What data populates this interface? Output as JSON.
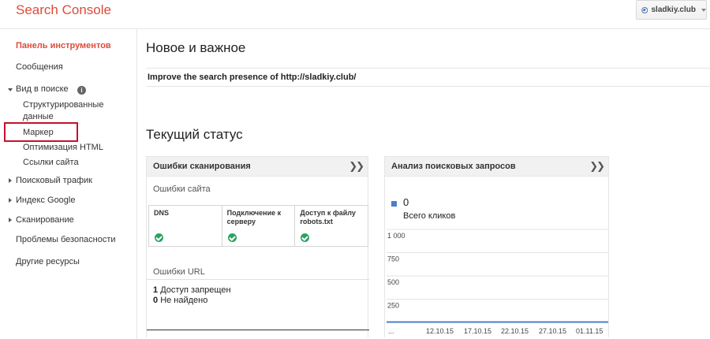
{
  "header": {
    "brand": "Search Console",
    "site": "sladkiy.club"
  },
  "sidebar": {
    "dashboard": "Панель инструментов",
    "messages": "Сообщения",
    "search_appearance": "Вид в поиске",
    "structured_data_line1": "Структурированные",
    "structured_data_line2": "данные",
    "marker": "Маркер",
    "html_optimization": "Оптимизация HTML",
    "sitelinks": "Ссылки сайта",
    "search_traffic": "Поисковый трафик",
    "google_index": "Индекс Google",
    "crawl": "Сканирование",
    "security": "Проблемы безопасности",
    "other_resources": "Другие ресурсы"
  },
  "main": {
    "title": "Новое и важное",
    "improve_text": "Improve the search presence of http://sladkiy.club/",
    "status_title": "Текущий статус"
  },
  "crawl_card": {
    "title": "Ошибки сканирования",
    "site_errors": "Ошибки сайта",
    "cells": [
      {
        "label": "DNS"
      },
      {
        "label": "Подключение к серверу"
      },
      {
        "label": "Доступ к файлу robots.txt"
      }
    ],
    "url_errors": "Ошибки URL",
    "access_denied_count": "1",
    "access_denied_label": "Доступ запрещен",
    "not_found_count": "0",
    "not_found_label": "Не найдено"
  },
  "analytics_card": {
    "title": "Анализ поисковых запросов",
    "total_value": "0",
    "total_label": "Всего кликов"
  },
  "colors": {
    "brand": "#dd4b39",
    "series": "#4d7ec9",
    "check": "#2aa35f",
    "highlight": "#c8102e"
  },
  "chart_data": {
    "type": "line",
    "y_ticks": [
      "1 000",
      "750",
      "500",
      "250"
    ],
    "x_ticks": [
      "...",
      "12.10.15",
      "17.10.15",
      "22.10.15",
      "27.10.15",
      "01.11.15"
    ],
    "ylim": [
      0,
      1000
    ],
    "series": [
      {
        "values": [
          0,
          0,
          0,
          0,
          0,
          0,
          0,
          0,
          0,
          0,
          0,
          0,
          0,
          0,
          0,
          0,
          0,
          0,
          0,
          0,
          0,
          0,
          0,
          0,
          0,
          0,
          0,
          0,
          0,
          0
        ]
      }
    ],
    "grid": true
  }
}
